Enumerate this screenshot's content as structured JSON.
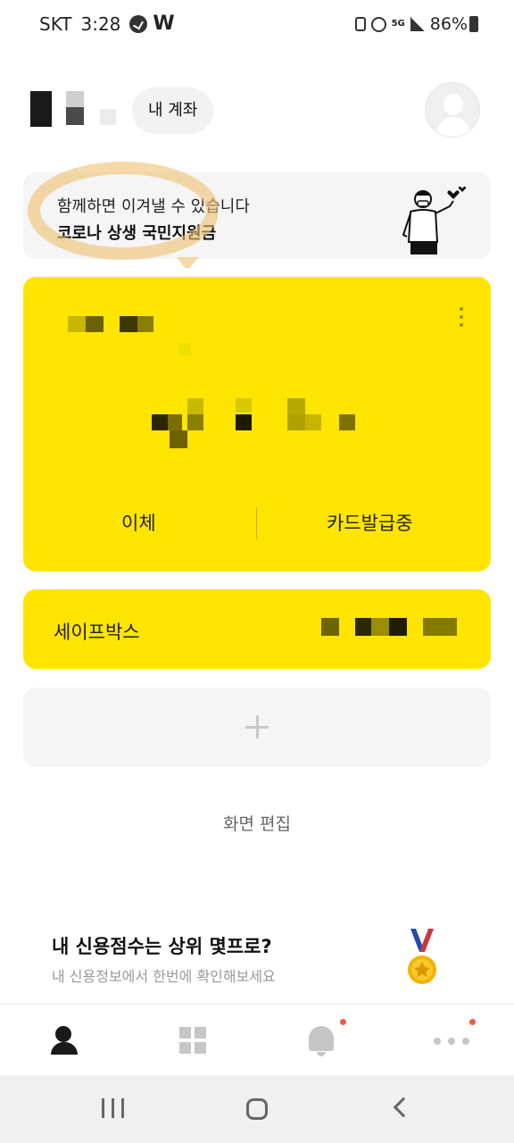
{
  "status_bar": {
    "carrier": "SKT",
    "time": "3:28",
    "w_logo": "W",
    "battery": "86%",
    "icons": [
      "circle-check-icon",
      "w-logo-icon",
      "battery-saver-icon",
      "alarm-icon",
      "5g-icon",
      "signal-icon",
      "battery-icon"
    ]
  },
  "header": {
    "my_account_label": "내 계좌"
  },
  "banner": {
    "line1": "함께하면 이겨낼 수 있습니다",
    "line2": "코로나 상생 국민지원금"
  },
  "account_card": {
    "transfer_label": "이체",
    "card_status_label": "카드발급중",
    "color": "#fee500"
  },
  "safebox": {
    "label": "세이프박스"
  },
  "edit_screen_label": "화면 편집",
  "credit_promo": {
    "title": "내 신용점수는 상위 몇프로?",
    "subtitle": "내 신용정보에서 한번에 확인해보세요"
  },
  "bottom_nav": {
    "items": [
      "person-icon",
      "grid-icon",
      "bell-icon",
      "more-icon"
    ],
    "badge_color": "#f05a4a"
  },
  "system_nav": {
    "items": [
      "recent-apps-icon",
      "home-icon",
      "back-icon"
    ]
  }
}
